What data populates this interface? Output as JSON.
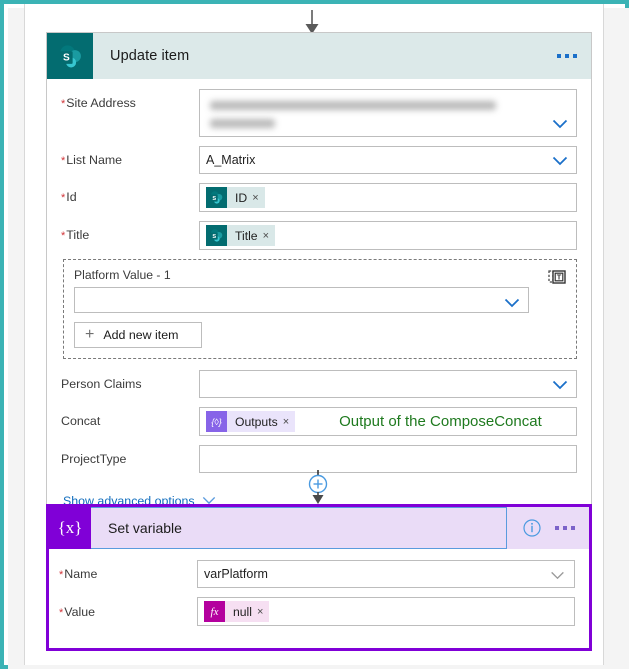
{
  "flow": {
    "top_connector_icon": "arrow-down-icon"
  },
  "update_item_card": {
    "icon": "sharepoint-icon",
    "title": "Update item",
    "menu_icon": "ellipsis-icon",
    "fields": [
      {
        "label": "Site Address",
        "required": true,
        "type": "dropdown",
        "value": "",
        "redacted": true
      },
      {
        "label": "List Name",
        "required": true,
        "type": "dropdown",
        "value": "A_Matrix"
      },
      {
        "label": "Id",
        "required": true,
        "type": "token",
        "token": {
          "icon": "sharepoint-icon",
          "text": "ID",
          "remove": "×"
        }
      },
      {
        "label": "Title",
        "required": true,
        "type": "token",
        "token": {
          "icon": "sharepoint-icon",
          "text": "Title",
          "remove": "×"
        }
      }
    ],
    "array_group": {
      "label_prefix": "Platform Value - ",
      "index": "1",
      "label_full": "Platform Value - 1",
      "delete_icon": "trash-icon",
      "select_value": "",
      "add_button": {
        "label": "Add new item",
        "icon": "plus-icon"
      }
    },
    "fields_after": [
      {
        "label": "Person Claims",
        "required": false,
        "type": "dropdown",
        "value": ""
      },
      {
        "label": "Concat",
        "required": false,
        "type": "token",
        "token": {
          "icon": "outputs-icon",
          "icon_glyph": "{◊}",
          "text": "Outputs",
          "remove": "×"
        },
        "annotation": "Output of the ComposeConcat",
        "annotation_color": "#1f7a1f"
      },
      {
        "label": "ProjectType",
        "required": false,
        "type": "text",
        "value": ""
      }
    ],
    "advanced_link": "Show advanced options",
    "advanced_chevron": "chevron-down-icon"
  },
  "connector": {
    "add_step_icon": "plus-circle-icon",
    "arrow_icon": "arrow-down-icon"
  },
  "set_variable_card": {
    "icon": "braces-x-icon",
    "icon_glyph": "{x}",
    "title": "Set variable",
    "info_icon": "info-icon",
    "menu_icon": "ellipsis-icon",
    "selected": true,
    "fields": [
      {
        "label": "Name",
        "required": true,
        "type": "dropdown",
        "value": "varPlatform"
      },
      {
        "label": "Value",
        "required": true,
        "type": "token",
        "token": {
          "icon": "fx-icon",
          "icon_glyph": "fx",
          "text": "null",
          "remove": "×"
        }
      }
    ]
  },
  "colors": {
    "frame": "#3bb3b5",
    "sharepoint_teal": "#036c70",
    "sharepoint_header": "#dce9e9",
    "setvar_purple": "#8000d7",
    "setvar_header": "#eadcf7",
    "link_blue": "#0f6cbd",
    "required_red": "#d13438",
    "annotation_green": "#1f7a1f",
    "outputs_purple": "#8764e8",
    "fx_magenta": "#b4009e"
  }
}
